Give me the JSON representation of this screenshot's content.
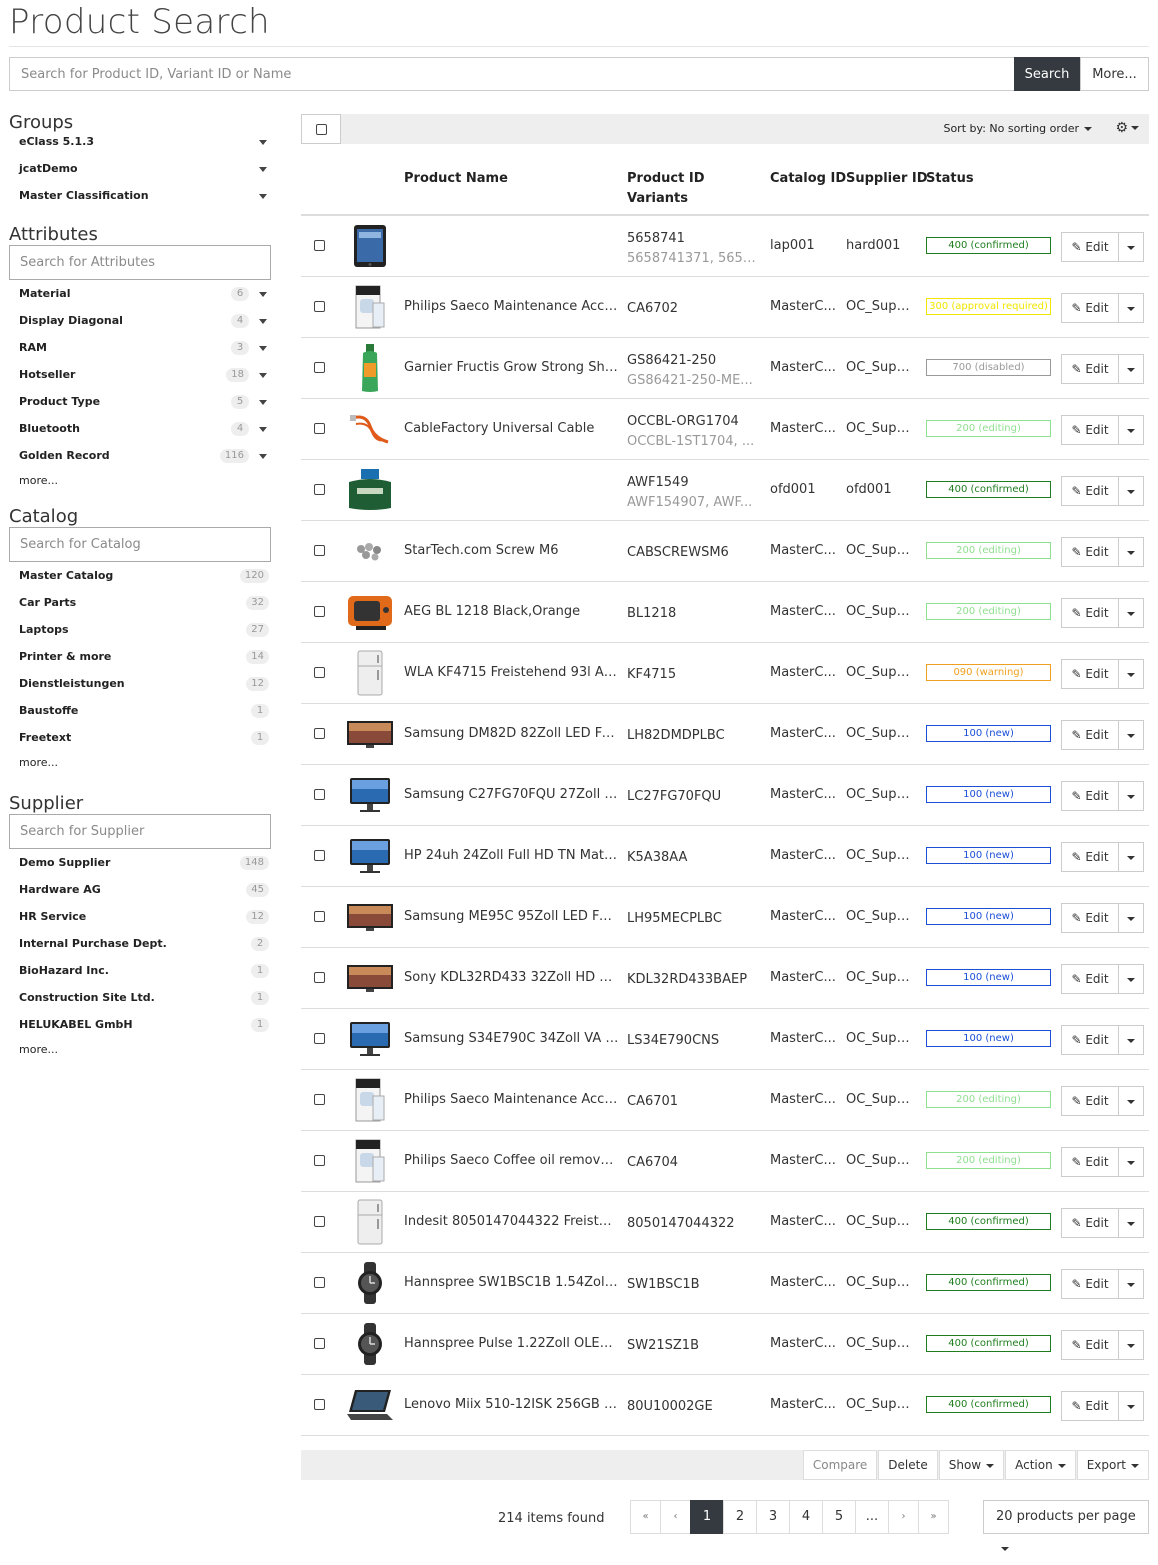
{
  "page": {
    "title": "Product Search"
  },
  "search": {
    "placeholder": "Search for Product ID, Variant ID or Name",
    "button": "Search",
    "more": "More..."
  },
  "sidebar": {
    "groups": {
      "title": "Groups",
      "items": [
        "eClass 5.1.3",
        "jcatDemo",
        "Master Classification"
      ]
    },
    "attributes": {
      "title": "Attributes",
      "placeholder": "Search for Attributes",
      "items": [
        {
          "label": "Material",
          "count": "6"
        },
        {
          "label": "Display Diagonal",
          "count": "4"
        },
        {
          "label": "RAM",
          "count": "3"
        },
        {
          "label": "Hotseller",
          "count": "18"
        },
        {
          "label": "Product Type",
          "count": "5"
        },
        {
          "label": "Bluetooth",
          "count": "4"
        },
        {
          "label": "Golden Record",
          "count": "116"
        }
      ],
      "more": "more..."
    },
    "catalog": {
      "title": "Catalog",
      "placeholder": "Search for Catalog",
      "items": [
        {
          "label": "Master Catalog",
          "count": "120"
        },
        {
          "label": "Car Parts",
          "count": "32"
        },
        {
          "label": "Laptops",
          "count": "27"
        },
        {
          "label": "Printer & more",
          "count": "14"
        },
        {
          "label": "Dienstleistungen",
          "count": "12"
        },
        {
          "label": "Baustoffe",
          "count": "1"
        },
        {
          "label": "Freetext",
          "count": "1"
        }
      ],
      "more": "more..."
    },
    "supplier": {
      "title": "Supplier",
      "placeholder": "Search for Supplier",
      "items": [
        {
          "label": "Demo Supplier",
          "count": "148"
        },
        {
          "label": "Hardware AG",
          "count": "45"
        },
        {
          "label": "HR Service",
          "count": "12"
        },
        {
          "label": "Internal Purchase Dept.",
          "count": "2"
        },
        {
          "label": "BioHazard Inc.",
          "count": "1"
        },
        {
          "label": "Construction Site Ltd.",
          "count": "1"
        },
        {
          "label": "HELUKABEL GmbH",
          "count": "1"
        }
      ],
      "more": "more..."
    }
  },
  "toolbar": {
    "sort_label": "Sort by: No sorting order"
  },
  "table": {
    "headers": {
      "name": "Product Name",
      "pid": "Product ID",
      "variants": "Variants",
      "catalog": "Catalog ID",
      "supplier": "Supplier ID",
      "status": "Status"
    },
    "edit_label": "Edit",
    "rows": [
      {
        "name": "",
        "pid": "5658741",
        "variants": "5658741371, 5658...",
        "catalog": "lap001",
        "supplier": "hard001",
        "status": "400 (confirmed)",
        "status_color": "#1e7e1e",
        "thumb": "tablet-thumb"
      },
      {
        "name": "Philips Saeco Maintenance Acces...",
        "pid": "CA6702",
        "variants": "",
        "catalog": "MasterC...",
        "supplier": "OC_Supp...",
        "status": "300 (approval required)",
        "status_color": "#f2e600",
        "thumb": "box-thumb"
      },
      {
        "name": "Garnier Fructis Grow Strong Sha...",
        "pid": "GS86421-250",
        "variants": "GS86421-250-ME...",
        "catalog": "MasterC...",
        "supplier": "OC_Supp...",
        "status": "700 (disabled)",
        "status_color": "#999999",
        "thumb": "bottle-thumb"
      },
      {
        "name": "CableFactory Universal Cable",
        "pid": "OCCBL-ORG1704",
        "variants": "OCCBL-1ST1704, ...",
        "catalog": "MasterC...",
        "supplier": "OC_Supp...",
        "status": "200 (editing)",
        "status_color": "#8fe08f",
        "thumb": "cable-thumb"
      },
      {
        "name": "",
        "pid": "AWF1549",
        "variants": "AWF154907, AWF...",
        "catalog": "ofd001",
        "supplier": "ofd001",
        "status": "400 (confirmed)",
        "status_color": "#1e7e1e",
        "thumb": "ink-thumb"
      },
      {
        "name": "StarTech.com Screw M6",
        "pid": "CABSCREWSM6",
        "variants": "",
        "catalog": "MasterC...",
        "supplier": "OC_Supp...",
        "status": "200 (editing)",
        "status_color": "#8fe08f",
        "thumb": "screw-thumb"
      },
      {
        "name": "AEG BL 1218 Black,Orange",
        "pid": "BL1218",
        "variants": "",
        "catalog": "MasterC...",
        "supplier": "OC_Supp...",
        "status": "200 (editing)",
        "status_color": "#8fe08f",
        "thumb": "device-thumb"
      },
      {
        "name": "WLA KF4715 Freistehend 93l A+...",
        "pid": "KF4715",
        "variants": "",
        "catalog": "MasterC...",
        "supplier": "OC_Supp...",
        "status": "090 (warning)",
        "status_color": "#f0a020",
        "thumb": "fridge-thumb"
      },
      {
        "name": "Samsung DM82D 82Zoll LED Ful...",
        "pid": "LH82DMDPLBC",
        "variants": "",
        "catalog": "MasterC...",
        "supplier": "OC_Supp...",
        "status": "100 (new)",
        "status_color": "#1a4fd6",
        "thumb": "tv-thumb"
      },
      {
        "name": "Samsung C27FG70FQU 27Zoll F...",
        "pid": "LC27FG70FQU",
        "variants": "",
        "catalog": "MasterC...",
        "supplier": "OC_Supp...",
        "status": "100 (new)",
        "status_color": "#1a4fd6",
        "thumb": "monitor-thumb"
      },
      {
        "name": "HP 24uh 24Zoll Full HD TN Matt ...",
        "pid": "K5A38AA",
        "variants": "",
        "catalog": "MasterC...",
        "supplier": "OC_Supp...",
        "status": "100 (new)",
        "status_color": "#1a4fd6",
        "thumb": "monitor-thumb"
      },
      {
        "name": "Samsung ME95C 95Zoll LED Full...",
        "pid": "LH95MECPLBC",
        "variants": "",
        "catalog": "MasterC...",
        "supplier": "OC_Supp...",
        "status": "100 (new)",
        "status_color": "#1a4fd6",
        "thumb": "tv-thumb"
      },
      {
        "name": "Sony KDL32RD433 32Zoll HD S...",
        "pid": "KDL32RD433BAEP",
        "variants": "",
        "catalog": "MasterC...",
        "supplier": "OC_Supp...",
        "status": "100 (new)",
        "status_color": "#1a4fd6",
        "thumb": "tv-thumb"
      },
      {
        "name": "Samsung S34E790C 34Zoll VA S...",
        "pid": "LS34E790CNS",
        "variants": "",
        "catalog": "MasterC...",
        "supplier": "OC_Supp...",
        "status": "100 (new)",
        "status_color": "#1a4fd6",
        "thumb": "monitor-thumb"
      },
      {
        "name": "Philips Saeco Maintenance Acces...",
        "pid": "CA6701",
        "variants": "",
        "catalog": "MasterC...",
        "supplier": "OC_Supp...",
        "status": "200 (editing)",
        "status_color": "#8fe08f",
        "thumb": "box-thumb"
      },
      {
        "name": "Philips Saeco Coffee oil remover ...",
        "pid": "CA6704",
        "variants": "",
        "catalog": "MasterC...",
        "supplier": "OC_Supp...",
        "status": "200 (editing)",
        "status_color": "#8fe08f",
        "thumb": "box-thumb"
      },
      {
        "name": "Indesit 8050147044322 Freiste...",
        "pid": "8050147044322",
        "variants": "",
        "catalog": "MasterC...",
        "supplier": "OC_Supp...",
        "status": "400 (confirmed)",
        "status_color": "#1e7e1e",
        "thumb": "fridge-thumb"
      },
      {
        "name": "Hannspree SW1BSC1B 1.54Zoll ...",
        "pid": "SW1BSC1B",
        "variants": "",
        "catalog": "MasterC...",
        "supplier": "OC_Supp...",
        "status": "400 (confirmed)",
        "status_color": "#1e7e1e",
        "thumb": "watch-thumb"
      },
      {
        "name": "Hannspree Pulse 1.22Zoll OLED ...",
        "pid": "SW21SZ1B",
        "variants": "",
        "catalog": "MasterC...",
        "supplier": "OC_Supp...",
        "status": "400 (confirmed)",
        "status_color": "#1e7e1e",
        "thumb": "watch-thumb"
      },
      {
        "name": "Lenovo Miix 510-12ISK 256GB S...",
        "pid": "80U10002GE",
        "variants": "",
        "catalog": "MasterC...",
        "supplier": "OC_Supp...",
        "status": "400 (confirmed)",
        "status_color": "#1e7e1e",
        "thumb": "laptop-thumb"
      }
    ]
  },
  "bottom": {
    "buttons": [
      {
        "label": "Compare",
        "caret": false,
        "disabled": true
      },
      {
        "label": "Delete",
        "caret": false,
        "disabled": false
      },
      {
        "label": "Show",
        "caret": true,
        "disabled": false
      },
      {
        "label": "Action",
        "caret": true,
        "disabled": false
      },
      {
        "label": "Export",
        "caret": true,
        "disabled": false
      }
    ],
    "items_found": "214 items found",
    "pager": {
      "first": "«",
      "prev": "‹",
      "pages": [
        "1",
        "2",
        "3",
        "4",
        "5",
        "..."
      ],
      "next": "›",
      "last": "»",
      "active": "1"
    },
    "per_page": "20 products per page"
  },
  "colors": {
    "dark": "#343a40",
    "toolbar_bg": "#eeeeee"
  }
}
